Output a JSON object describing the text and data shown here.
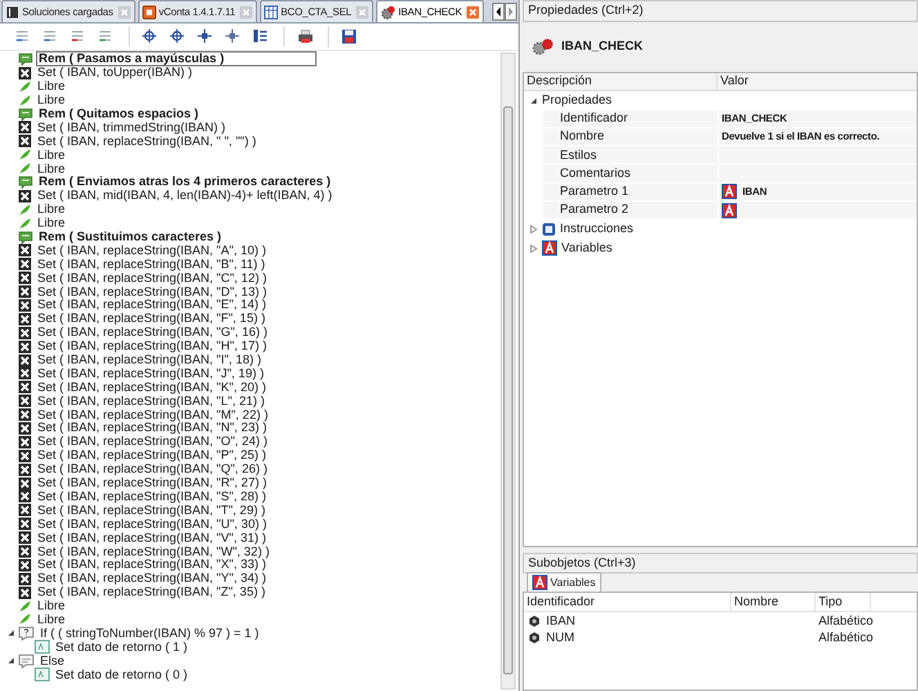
{
  "tabs": [
    {
      "label": "Soluciones cargadas",
      "kind": "solutions",
      "selected": false
    },
    {
      "label": "vConta 1.4.1.7.11",
      "kind": "app",
      "selected": false
    },
    {
      "label": "BCO_CTA_SEL",
      "kind": "table",
      "selected": false
    },
    {
      "label": "IBAN_CHECK",
      "kind": "process",
      "selected": true
    }
  ],
  "code": [
    {
      "kind": "rem",
      "text": "Rem ( Pasamos a mayúsculas )",
      "selected": true
    },
    {
      "kind": "set",
      "text": "Set ( IBAN, toUpper(IBAN) )",
      "selected": false
    },
    {
      "kind": "libre",
      "text": "Libre",
      "selected": false
    },
    {
      "kind": "libre",
      "text": "Libre",
      "selected": false
    },
    {
      "kind": "rem",
      "text": "Rem ( Quitamos espacios )",
      "selected": false
    },
    {
      "kind": "set",
      "text": "Set ( IBAN, trimmedString(IBAN) )",
      "selected": false
    },
    {
      "kind": "set",
      "text": "Set ( IBAN, replaceString(IBAN, \" \", \"\") )",
      "selected": false
    },
    {
      "kind": "libre",
      "text": "Libre",
      "selected": false
    },
    {
      "kind": "libre",
      "text": "Libre",
      "selected": false
    },
    {
      "kind": "rem",
      "text": "Rem ( Enviamos atras los 4 primeros caracteres )",
      "selected": false
    },
    {
      "kind": "set",
      "text": "Set ( IBAN, mid(IBAN, 4, len(IBAN)-4)+ left(IBAN, 4) )",
      "selected": false
    },
    {
      "kind": "libre",
      "text": "Libre",
      "selected": false
    },
    {
      "kind": "libre",
      "text": "Libre",
      "selected": false
    },
    {
      "kind": "rem",
      "text": "Rem ( Sustituimos caracteres )",
      "selected": false
    },
    {
      "kind": "set",
      "text": "Set ( IBAN, replaceString(IBAN, \"A\", 10) )",
      "selected": false
    },
    {
      "kind": "set",
      "text": "Set ( IBAN, replaceString(IBAN, \"B\", 11) )",
      "selected": false
    },
    {
      "kind": "set",
      "text": "Set ( IBAN, replaceString(IBAN, \"C\", 12) )",
      "selected": false
    },
    {
      "kind": "set",
      "text": "Set ( IBAN, replaceString(IBAN, \"D\", 13) )",
      "selected": false
    },
    {
      "kind": "set",
      "text": "Set ( IBAN, replaceString(IBAN, \"E\", 14) )",
      "selected": false
    },
    {
      "kind": "set",
      "text": "Set ( IBAN, replaceString(IBAN, \"F\", 15) )",
      "selected": false
    },
    {
      "kind": "set",
      "text": "Set ( IBAN, replaceString(IBAN, \"G\", 16) )",
      "selected": false
    },
    {
      "kind": "set",
      "text": "Set ( IBAN, replaceString(IBAN, \"H\", 17) )",
      "selected": false
    },
    {
      "kind": "set",
      "text": "Set ( IBAN, replaceString(IBAN, \"I\", 18) )",
      "selected": false
    },
    {
      "kind": "set",
      "text": "Set ( IBAN, replaceString(IBAN, \"J\", 19) )",
      "selected": false
    },
    {
      "kind": "set",
      "text": "Set ( IBAN, replaceString(IBAN, \"K\", 20) )",
      "selected": false
    },
    {
      "kind": "set",
      "text": "Set ( IBAN, replaceString(IBAN, \"L\", 21) )",
      "selected": false
    },
    {
      "kind": "set",
      "text": "Set ( IBAN, replaceString(IBAN, \"M\", 22) )",
      "selected": false
    },
    {
      "kind": "set",
      "text": "Set ( IBAN, replaceString(IBAN, \"N\", 23) )",
      "selected": false
    },
    {
      "kind": "set",
      "text": "Set ( IBAN, replaceString(IBAN, \"O\", 24) )",
      "selected": false
    },
    {
      "kind": "set",
      "text": "Set ( IBAN, replaceString(IBAN, \"P\", 25) )",
      "selected": false
    },
    {
      "kind": "set",
      "text": "Set ( IBAN, replaceString(IBAN, \"Q\", 26) )",
      "selected": false
    },
    {
      "kind": "set",
      "text": "Set ( IBAN, replaceString(IBAN, \"R\", 27) )",
      "selected": false
    },
    {
      "kind": "set",
      "text": "Set ( IBAN, replaceString(IBAN, \"S\", 28) )",
      "selected": false
    },
    {
      "kind": "set",
      "text": "Set ( IBAN, replaceString(IBAN, \"T\", 29) )",
      "selected": false
    },
    {
      "kind": "set",
      "text": "Set ( IBAN, replaceString(IBAN, \"U\", 30) )",
      "selected": false
    },
    {
      "kind": "set",
      "text": "Set ( IBAN, replaceString(IBAN, \"V\", 31) )",
      "selected": false
    },
    {
      "kind": "set",
      "text": "Set ( IBAN, replaceString(IBAN, \"W\", 32) )",
      "selected": false
    },
    {
      "kind": "set",
      "text": "Set ( IBAN, replaceString(IBAN, \"X\", 33) )",
      "selected": false
    },
    {
      "kind": "set",
      "text": "Set ( IBAN, replaceString(IBAN, \"Y\", 34) )",
      "selected": false
    },
    {
      "kind": "set",
      "text": "Set ( IBAN, replaceString(IBAN, \"Z\", 35) )",
      "selected": false
    },
    {
      "kind": "libre",
      "text": "Libre",
      "selected": false
    },
    {
      "kind": "libre",
      "text": "Libre",
      "selected": false
    },
    {
      "kind": "if",
      "text": "If ( ( stringToNumber(IBAN) % 97 ) = 1 )",
      "selected": false,
      "expanded": true,
      "children": [
        {
          "kind": "return",
          "text": "Set dato de retorno ( 1 )",
          "selected": false
        }
      ]
    },
    {
      "kind": "else",
      "text": "Else",
      "selected": false,
      "expanded": true,
      "children": [
        {
          "kind": "return",
          "text": "Set dato de retorno ( 0 )",
          "selected": false
        }
      ]
    }
  ],
  "properties": {
    "title": "Propiedades (Ctrl+2)",
    "object_name": "IBAN_CHECK",
    "columns": [
      "Descripción",
      "Valor"
    ],
    "groups": [
      {
        "label": "Propiedades",
        "kind": "plain",
        "expanded": true,
        "rows": [
          {
            "name": "Identificador",
            "value": "IBAN_CHECK",
            "value_icon": false
          },
          {
            "name": "Nombre",
            "value": "Devuelve 1 si el IBAN es correcto.",
            "value_icon": false
          },
          {
            "name": "Estilos",
            "value_icon": false
          },
          {
            "name": "Comentarios",
            "value_icon": false
          },
          {
            "name": "Parametro 1",
            "value": "IBAN",
            "value_icon": true
          },
          {
            "name": "Parametro 2",
            "value_icon": true
          }
        ]
      },
      {
        "label": "Instrucciones",
        "kind": "instructions",
        "expanded": false
      },
      {
        "label": "Variables",
        "kind": "variables",
        "expanded": false
      }
    ]
  },
  "subobjects": {
    "title": "Subobjetos (Ctrl+3)",
    "tabs": [
      {
        "label": "Variables",
        "selected": true
      }
    ],
    "columns": [
      "Identificador",
      "Nombre",
      "Tipo"
    ],
    "rows": [
      {
        "identifier": "IBAN",
        "type": "Alfabético"
      },
      {
        "identifier": "NUM",
        "type": "Alfabético"
      }
    ]
  }
}
